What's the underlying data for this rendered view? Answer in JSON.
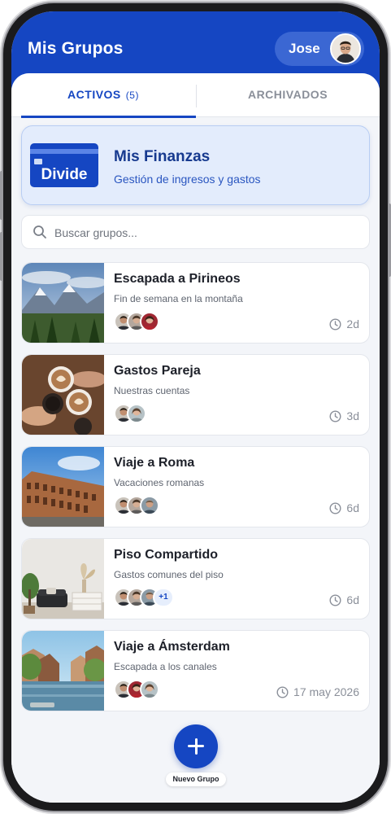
{
  "header": {
    "title": "Mis Grupos",
    "user_name": "Jose"
  },
  "tabs": [
    {
      "label": "ACTIVOS",
      "count": "(5)",
      "active": true
    },
    {
      "label": "ARCHIVADOS",
      "active": false
    }
  ],
  "finance_card": {
    "card_word": "Divide",
    "title": "Mis Finanzas",
    "subtitle": "Gestión de ingresos y gastos"
  },
  "search": {
    "placeholder": "Buscar grupos..."
  },
  "groups": [
    {
      "title": "Escapada a Pirineos",
      "subtitle": "Fin de semana en la montaña",
      "time": "2d",
      "extra_members": ""
    },
    {
      "title": "Gastos Pareja",
      "subtitle": "Nuestras cuentas",
      "time": "3d",
      "extra_members": ""
    },
    {
      "title": "Viaje a Roma",
      "subtitle": "Vacaciones romanas",
      "time": "6d",
      "extra_members": ""
    },
    {
      "title": "Piso Compartido",
      "subtitle": "Gastos comunes del piso",
      "time": "6d",
      "extra_members": "+1"
    },
    {
      "title": "Viaje a Ámsterdam",
      "subtitle": "Escapada a los canales",
      "time": "17 may 2026",
      "extra_members": ""
    }
  ],
  "fab": {
    "label": "Nuevo Grupo"
  },
  "colors": {
    "primary": "#1546c2",
    "accent_card": "#e3ecfc",
    "background": "#f3f5f9"
  }
}
